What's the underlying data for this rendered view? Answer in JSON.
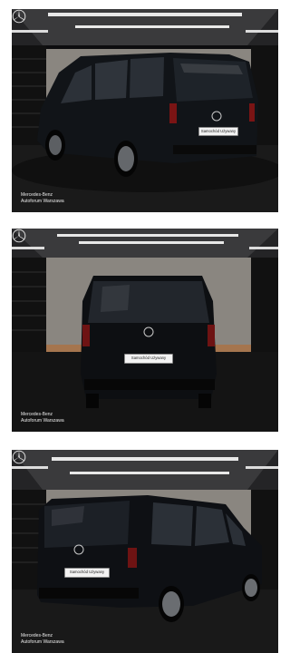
{
  "gallery": {
    "photos": [
      {
        "dealer_line1": "Mercedes-Benz",
        "dealer_line2": "Autoforum Warszawa",
        "plate": "Samochód Używany"
      },
      {
        "dealer_line1": "Mercedes-Benz",
        "dealer_line2": "Autoforum Warszawa",
        "plate": "Samochód Używany"
      },
      {
        "dealer_line1": "Mercedes-Benz",
        "dealer_line2": "Autoforum Warszawa",
        "plate": "Samochód Używany"
      }
    ]
  },
  "icons": [
    "mercedes-star-icon"
  ],
  "colors": {
    "van": "#101216",
    "floor": "#151515",
    "wall": "#8b8781",
    "ceiling": "#2b2b2d"
  }
}
